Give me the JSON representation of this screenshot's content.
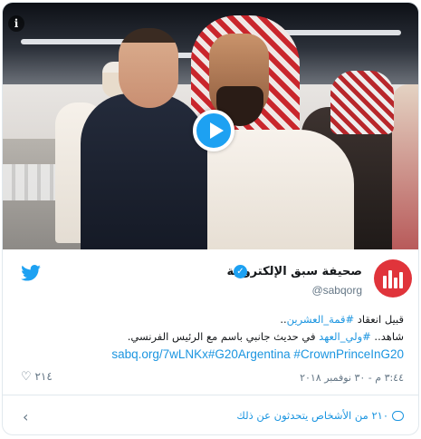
{
  "media": {
    "info_icon": "i",
    "play_icon": "play-icon"
  },
  "account": {
    "display_name": "صحيفة سبق الإلكترونية",
    "handle": "@sabqorg",
    "verified_icon": "check-icon"
  },
  "tweet": {
    "line1_prefix": "قبيل انعقاد ",
    "line1_hashtag": "#قمة_العشرين",
    "line1_suffix": "..",
    "line2_prefix": "شاهد.. ",
    "line2_hashtag": "#ولي_العهد",
    "line2_suffix": " في حديث جانبي باسم مع الرئيس الفرنسي.",
    "line3": "sabq.org/7wLNKx#G20Argentina #CrownPrinceInG20"
  },
  "meta": {
    "timestamp": "٣:٤٤ م - ٣٠ نوفمبر ٢٠١٨",
    "likes": "٢١٤"
  },
  "footer": {
    "conversation": "٢١٠ من الأشخاص يتحدثون عن ذلك"
  },
  "colors": {
    "twitter_blue": "#1da1f2",
    "link_blue": "#1b95e0",
    "brand_red": "#e0343b"
  }
}
